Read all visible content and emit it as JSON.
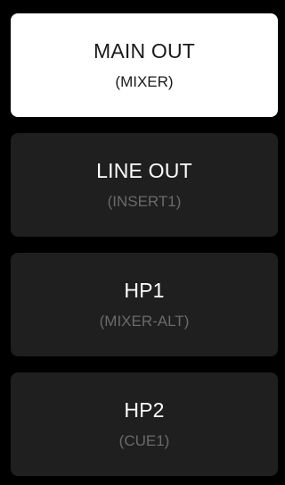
{
  "outputs": [
    {
      "label": "MAIN OUT",
      "source": "(MIXER)",
      "selected": true
    },
    {
      "label": "LINE OUT",
      "source": "(INSERT1)",
      "selected": false
    },
    {
      "label": "HP1",
      "source": "(MIXER-ALT)",
      "selected": false
    },
    {
      "label": "HP2",
      "source": "(CUE1)",
      "selected": false
    }
  ],
  "colors": {
    "background": "#000000",
    "button_inactive": "#1f1f1f",
    "button_active": "#ffffff",
    "text_active": "#1a1a1a",
    "title_inactive": "#ffffff",
    "source_inactive": "#6a6a6a"
  }
}
